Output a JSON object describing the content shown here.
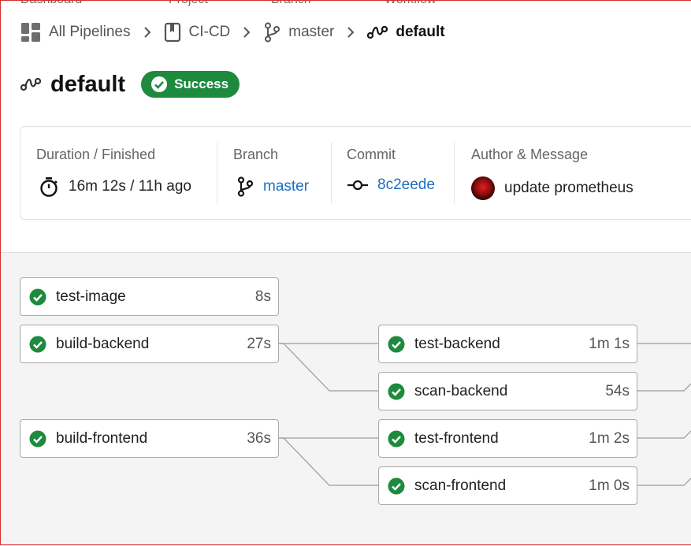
{
  "breadcrumb": {
    "headers": [
      "Dashboard",
      "Project",
      "Branch",
      "Workflow"
    ],
    "items": [
      {
        "label": "All Pipelines",
        "icon": "dashboard-icon"
      },
      {
        "label": "CI-CD",
        "icon": "project-icon"
      },
      {
        "label": "master",
        "icon": "branch-icon"
      },
      {
        "label": "default",
        "icon": "workflow-icon"
      }
    ]
  },
  "title": "default",
  "status": {
    "label": "Success",
    "color": "#1e8a3e"
  },
  "info": {
    "duration_label": "Duration / Finished",
    "duration_value": "16m 12s / 11h ago",
    "branch_label": "Branch",
    "branch_value": "master",
    "commit_label": "Commit",
    "commit_value": "8c2eede",
    "author_label": "Author & Message",
    "author_message": "update prometheus"
  },
  "jobs": {
    "col1": [
      {
        "name": "test-image",
        "duration": "8s"
      },
      {
        "name": "build-backend",
        "duration": "27s"
      },
      {
        "name": "build-frontend",
        "duration": "36s"
      }
    ],
    "col2": [
      {
        "name": "test-backend",
        "duration": "1m 1s"
      },
      {
        "name": "scan-backend",
        "duration": "54s"
      },
      {
        "name": "test-frontend",
        "duration": "1m 2s"
      },
      {
        "name": "scan-frontend",
        "duration": "1m 0s"
      }
    ]
  },
  "colors": {
    "success": "#1e8a3e",
    "link": "#1d6fbf",
    "connector": "#9a9a9a"
  }
}
